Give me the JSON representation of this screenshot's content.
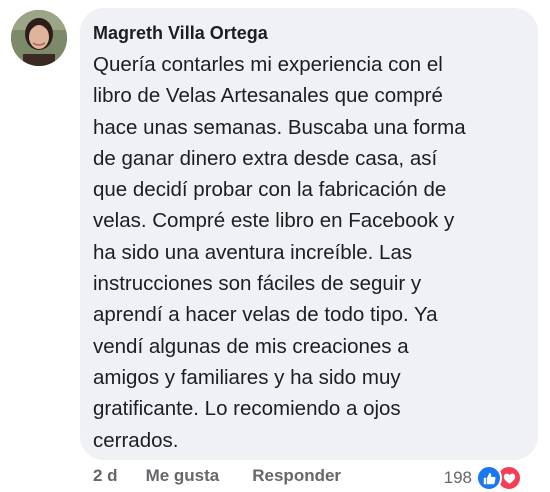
{
  "comment": {
    "author": "Magreth Villa Ortega",
    "lines": [
      "Quería contarles mi experiencia con el",
      "libro de Velas Artesanales que compré",
      "hace unas semanas. Buscaba una forma",
      "de ganar dinero extra desde casa, así",
      "que decidí probar con la fabricación de",
      "velas. Compré este libro en Facebook y",
      "ha sido una aventura increíble. Las",
      "instrucciones son fáciles de seguir y",
      "aprendí a hacer velas de todo tipo. Ya",
      "vendí algunas de mis creaciones a",
      "amigos y familiares y ha sido muy",
      "gratificante. Lo recomiendo a ojos",
      "cerrados."
    ]
  },
  "actions": {
    "timestamp": "2 d",
    "like_label": "Me gusta",
    "reply_label": "Responder"
  },
  "reactions": {
    "count": "198",
    "icons": [
      "like-icon",
      "love-icon"
    ],
    "colors": {
      "like": "#1877f2",
      "love": "#f33e58"
    }
  }
}
